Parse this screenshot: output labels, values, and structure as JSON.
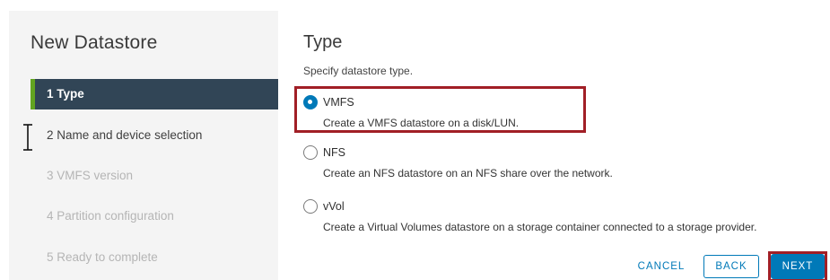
{
  "wizard": {
    "title": "New Datastore",
    "steps": [
      {
        "label": "1  Type",
        "state": "active"
      },
      {
        "label": "2  Name and device selection",
        "state": "enabled"
      },
      {
        "label": "3  VMFS version",
        "state": "disabled"
      },
      {
        "label": "4  Partition configuration",
        "state": "disabled"
      },
      {
        "label": "5  Ready to complete",
        "state": "disabled"
      }
    ]
  },
  "main": {
    "title": "Type",
    "subtitle": "Specify datastore type.",
    "options": [
      {
        "label": "VMFS",
        "description": "Create a VMFS datastore on a disk/LUN.",
        "selected": true
      },
      {
        "label": "NFS",
        "description": "Create an NFS datastore on an NFS share over the network.",
        "selected": false
      },
      {
        "label": "vVol",
        "description": "Create a Virtual Volumes datastore on a storage container connected to a storage provider.",
        "selected": false
      }
    ]
  },
  "footer": {
    "cancel_label": "CANCEL",
    "back_label": "BACK",
    "next_label": "NEXT"
  },
  "colors": {
    "accent": "#0079b8",
    "active_step_bg": "#314556",
    "active_step_marker": "#62a420",
    "highlight": "#a11f26"
  },
  "icons": {
    "cursor": "text-cursor-icon"
  }
}
